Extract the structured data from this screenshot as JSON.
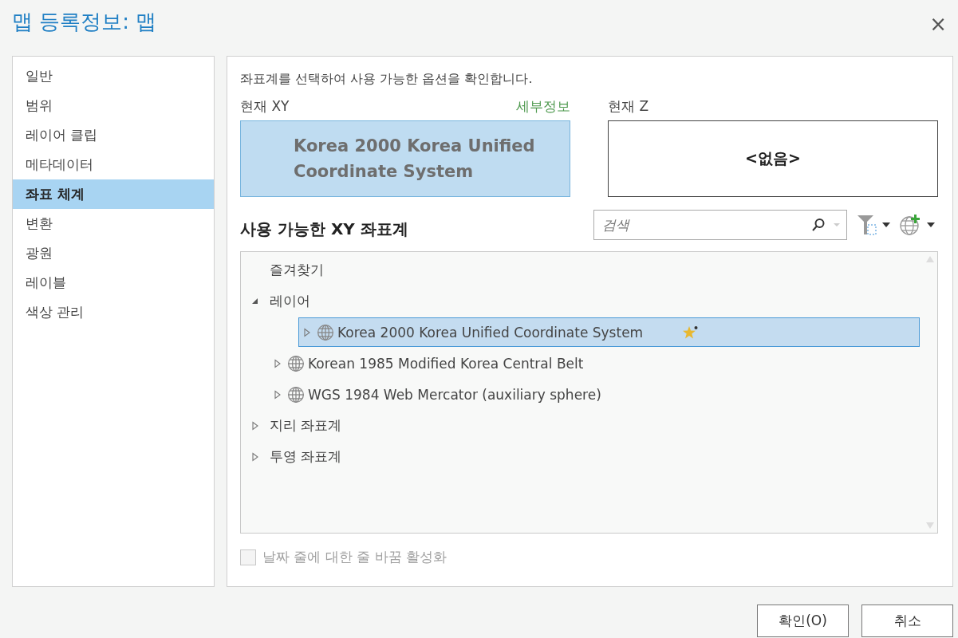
{
  "window": {
    "title": "맵 등록정보: 맵",
    "close": "×"
  },
  "sidebar": {
    "items": [
      {
        "label": "일반",
        "selected": false
      },
      {
        "label": "범위",
        "selected": false
      },
      {
        "label": "레이어 클립",
        "selected": false
      },
      {
        "label": "메타데이터",
        "selected": false
      },
      {
        "label": "좌표 체계",
        "selected": true
      },
      {
        "label": "변환",
        "selected": false
      },
      {
        "label": "광원",
        "selected": false
      },
      {
        "label": "레이블",
        "selected": false
      },
      {
        "label": "색상 관리",
        "selected": false
      }
    ]
  },
  "content": {
    "instruction": "좌표계를 선택하여 사용 가능한 옵션을 확인합니다.",
    "current_xy": {
      "label": "현재 XY",
      "details_link": "세부정보",
      "value": "Korea 2000 Korea Unified Coordinate System"
    },
    "current_z": {
      "label": "현재 Z",
      "value": "<없음>"
    },
    "available_heading": "사용 가능한 XY 좌표계",
    "search": {
      "placeholder": "검색"
    },
    "tree": [
      {
        "label": "즐겨찾기",
        "kind": "folder",
        "selected": false
      },
      {
        "label": "레이어",
        "kind": "folder",
        "expanded": true,
        "selected": false,
        "children": [
          {
            "label": "Korea 2000 Korea Unified Coordinate System",
            "kind": "system",
            "expanded": false,
            "selected": true,
            "favorite": true
          },
          {
            "label": "Korean 1985 Modified Korea Central Belt",
            "kind": "system",
            "expanded": false,
            "selected": false,
            "favorite": false
          },
          {
            "label": "WGS 1984 Web Mercator (auxiliary sphere)",
            "kind": "system",
            "expanded": false,
            "selected": false,
            "favorite": false
          }
        ]
      },
      {
        "label": "지리 좌표계",
        "kind": "folder",
        "expanded": false,
        "selected": false
      },
      {
        "label": "투영 좌표계",
        "kind": "folder",
        "expanded": false,
        "selected": false
      }
    ],
    "date_line_option": {
      "label": "날짜 줄에 대한 줄 바꿈 활성화",
      "checked": false,
      "disabled": true
    }
  },
  "buttons": [
    {
      "label": "확인(O)"
    },
    {
      "label": "취소"
    }
  ]
}
